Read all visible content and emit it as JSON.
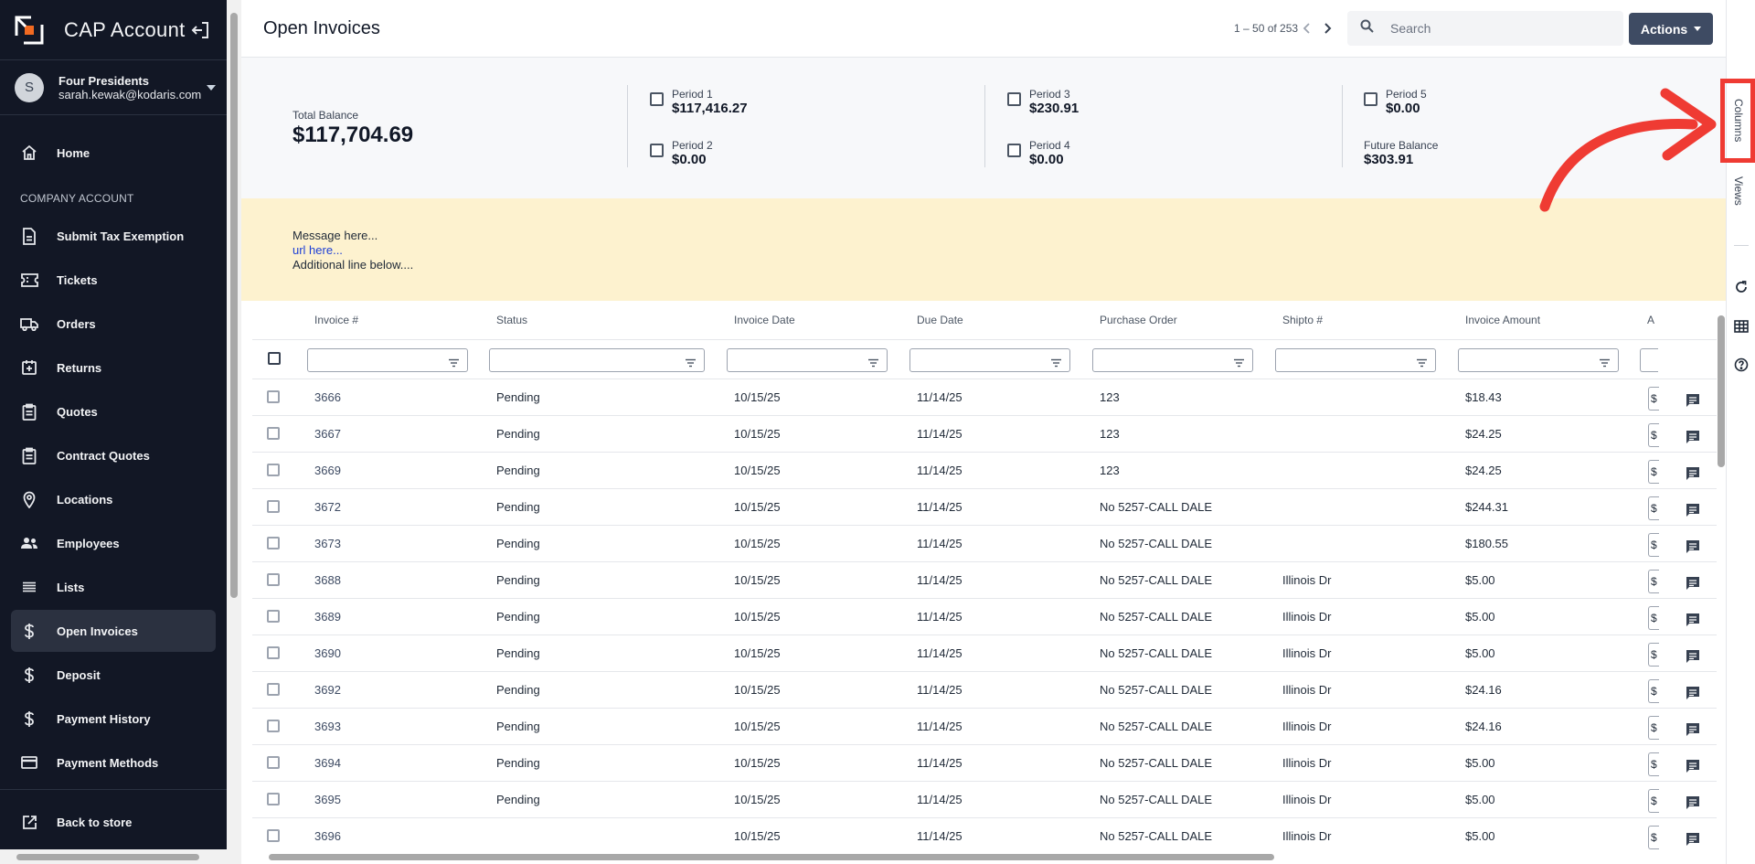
{
  "sidebar": {
    "brand_title": "CAP Account",
    "user": {
      "initial": "S",
      "name": "Four Presidents",
      "email": "sarah.kewak@kodaris.com"
    },
    "home": "Home",
    "section_label": "COMPANY ACCOUNT",
    "items": [
      {
        "label": "Submit Tax Exemption",
        "icon": "document-icon"
      },
      {
        "label": "Tickets",
        "icon": "ticket-icon"
      },
      {
        "label": "Orders",
        "icon": "truck-icon"
      },
      {
        "label": "Returns",
        "icon": "return-icon"
      },
      {
        "label": "Quotes",
        "icon": "clipboard-icon"
      },
      {
        "label": "Contract Quotes",
        "icon": "clipboard-icon"
      },
      {
        "label": "Locations",
        "icon": "location-pin-icon"
      },
      {
        "label": "Employees",
        "icon": "people-icon"
      },
      {
        "label": "Lists",
        "icon": "list-icon"
      },
      {
        "label": "Open Invoices",
        "icon": "dollar-icon",
        "active": true
      },
      {
        "label": "Deposit",
        "icon": "dollar-icon"
      },
      {
        "label": "Payment History",
        "icon": "dollar-icon"
      },
      {
        "label": "Payment Methods",
        "icon": "credit-card-icon"
      }
    ],
    "back_to_store": "Back to store"
  },
  "topbar": {
    "title": "Open Invoices",
    "pager_text": "1 – 50 of 253",
    "search_placeholder": "Search",
    "actions_label": "Actions"
  },
  "balances": {
    "total_label": "Total Balance",
    "total_value": "$117,704.69",
    "periods": [
      {
        "label": "Period 1",
        "value": "$117,416.27"
      },
      {
        "label": "Period 2",
        "value": "$0.00"
      },
      {
        "label": "Period 3",
        "value": "$230.91"
      },
      {
        "label": "Period 4",
        "value": "$0.00"
      },
      {
        "label": "Period 5",
        "value": "$0.00"
      }
    ],
    "future_label": "Future Balance",
    "future_value": "$303.91"
  },
  "message": {
    "line1": "Message here...",
    "link": "url here...",
    "line3": "Additional line below...."
  },
  "grid": {
    "columns": [
      "Invoice #",
      "Status",
      "Invoice Date",
      "Due Date",
      "Purchase Order",
      "Shipto #",
      "Invoice Amount",
      "A"
    ],
    "rows": [
      [
        "3666",
        "Pending",
        "10/15/25",
        "11/14/25",
        "123",
        "",
        "$18.43"
      ],
      [
        "3667",
        "Pending",
        "10/15/25",
        "11/14/25",
        "123",
        "",
        "$24.25"
      ],
      [
        "3669",
        "Pending",
        "10/15/25",
        "11/14/25",
        "123",
        "",
        "$24.25"
      ],
      [
        "3672",
        "Pending",
        "10/15/25",
        "11/14/25",
        "No 5257-CALL DALE",
        "",
        "$244.31"
      ],
      [
        "3673",
        "Pending",
        "10/15/25",
        "11/14/25",
        "No 5257-CALL DALE",
        "",
        "$180.55"
      ],
      [
        "3688",
        "Pending",
        "10/15/25",
        "11/14/25",
        "No 5257-CALL DALE",
        "Illinois Dr",
        "$5.00"
      ],
      [
        "3689",
        "Pending",
        "10/15/25",
        "11/14/25",
        "No 5257-CALL DALE",
        "Illinois Dr",
        "$5.00"
      ],
      [
        "3690",
        "Pending",
        "10/15/25",
        "11/14/25",
        "No 5257-CALL DALE",
        "Illinois Dr",
        "$5.00"
      ],
      [
        "3692",
        "Pending",
        "10/15/25",
        "11/14/25",
        "No 5257-CALL DALE",
        "Illinois Dr",
        "$24.16"
      ],
      [
        "3693",
        "Pending",
        "10/15/25",
        "11/14/25",
        "No 5257-CALL DALE",
        "Illinois Dr",
        "$24.16"
      ],
      [
        "3694",
        "Pending",
        "10/15/25",
        "11/14/25",
        "No 5257-CALL DALE",
        "Illinois Dr",
        "$5.00"
      ],
      [
        "3695",
        "Pending",
        "10/15/25",
        "11/14/25",
        "No 5257-CALL DALE",
        "Illinois Dr",
        "$5.00"
      ],
      [
        "3696",
        "",
        "10/15/25",
        "11/14/25",
        "No 5257-CALL DALE",
        "Illinois Dr",
        "$5.00"
      ]
    ],
    "truncated_cell_text": "$"
  },
  "toolpanel": {
    "columns_tab": "Columns",
    "views_tab": "Views",
    "icons": [
      "refresh-icon",
      "table-icon",
      "help-icon"
    ]
  },
  "colors": {
    "sidebar_bg": "#121725",
    "active_item_bg": "#2b3140",
    "actions_button": "#3e4b63",
    "message_bg": "#fdf2cf",
    "annotation": "#ef3b33"
  }
}
